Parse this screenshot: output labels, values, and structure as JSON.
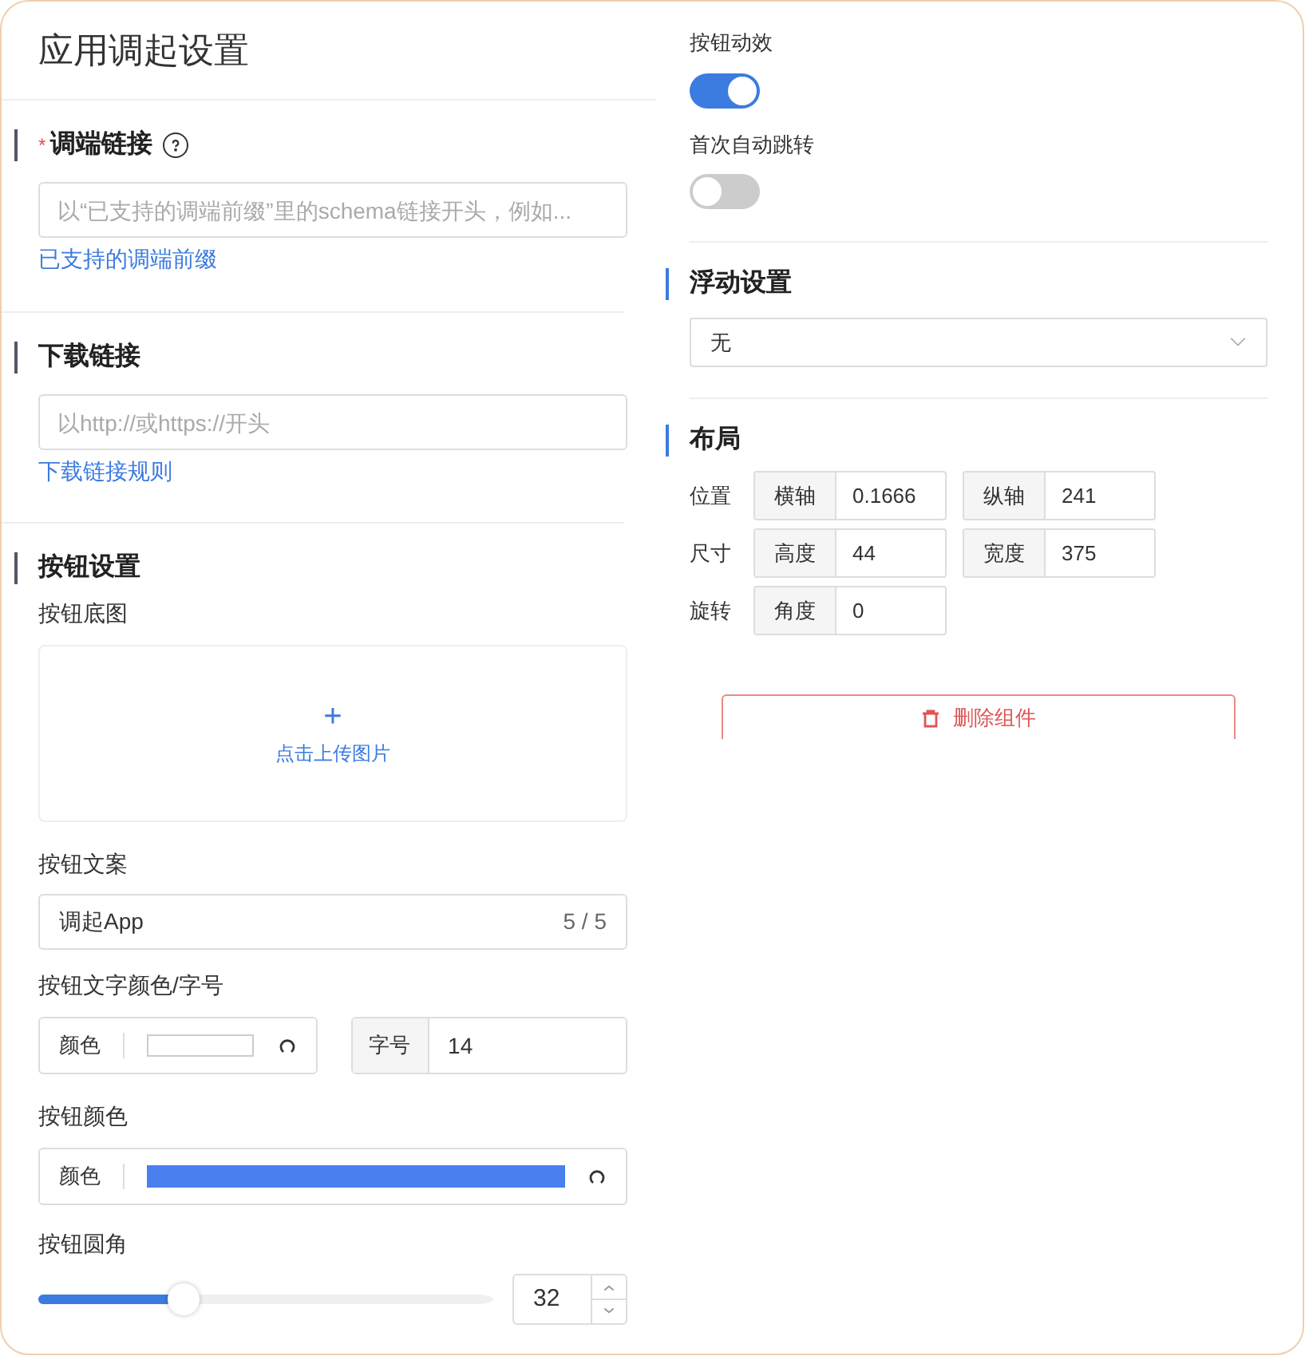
{
  "title": "应用调起设置",
  "deeplink": {
    "label": "调端链接",
    "required_mark": "*",
    "placeholder": "以“已支持的调端前缀”里的schema链接开头，例如...",
    "link": "已支持的调端前缀"
  },
  "download": {
    "label": "下载链接",
    "placeholder": "以http://或https://开头",
    "link": "下载链接规则"
  },
  "button_settings": {
    "label": "按钮设置",
    "image_label": "按钮底图",
    "upload_icon": "+",
    "upload_text": "点击上传图片",
    "text_label": "按钮文案",
    "text_value": "调起App",
    "text_count": "5 / 5",
    "text_style_label": "按钮文字颜色/字号",
    "text_color": {
      "tag": "颜色",
      "color": "#ffffff"
    },
    "font_size": {
      "tag": "字号",
      "value": "14"
    },
    "bg_label": "按钮颜色",
    "bg_color": {
      "tag": "颜色",
      "color": "#4a7ff0"
    },
    "radius_label": "按钮圆角",
    "radius": {
      "level": 0.32,
      "value": "32"
    }
  },
  "toggles": [
    {
      "label": "按钮动效",
      "on": true
    },
    {
      "label": "首次自动跳转",
      "on": false
    }
  ],
  "float": {
    "label": "浮动设置",
    "value": "无"
  },
  "layout": {
    "label": "布局",
    "rows": [
      {
        "label": "位置",
        "fields": [
          {
            "tag": "横轴",
            "value": "0.1666"
          },
          {
            "tag": "纵轴",
            "value": "241"
          }
        ]
      },
      {
        "label": "尺寸",
        "fields": [
          {
            "tag": "高度",
            "value": "44"
          },
          {
            "tag": "宽度",
            "value": "375"
          }
        ]
      },
      {
        "label": "旋转",
        "fields": [
          {
            "tag": "角度",
            "value": "0"
          }
        ]
      }
    ]
  },
  "delete_button": "删除组件"
}
